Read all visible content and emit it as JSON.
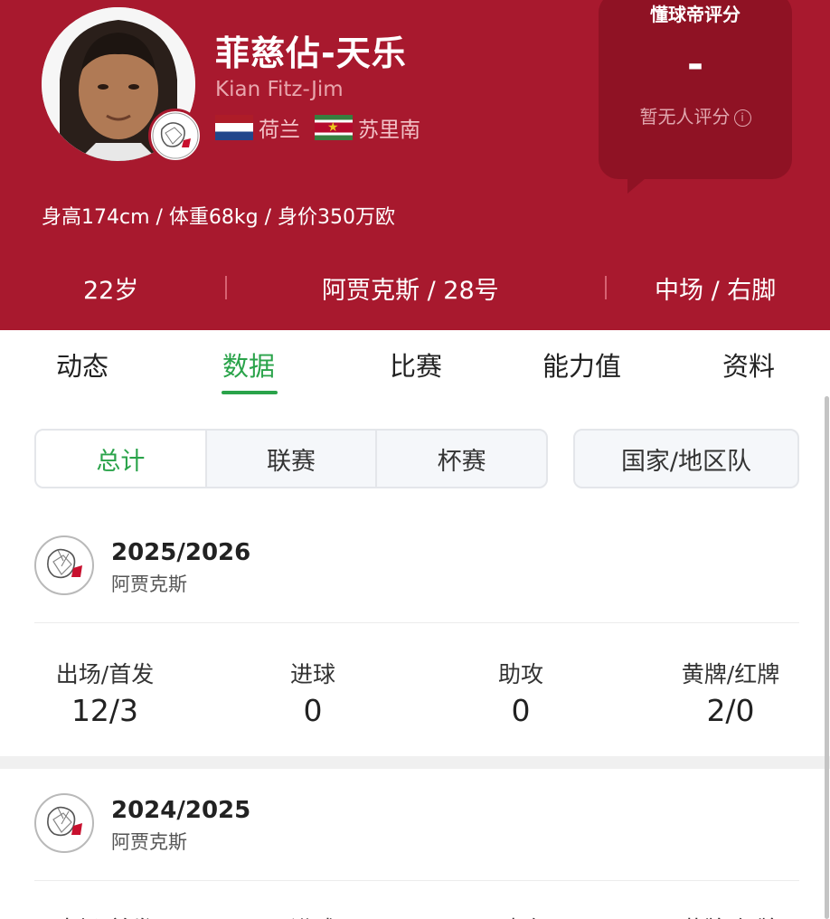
{
  "player": {
    "name_cn": "菲慈佔-天乐",
    "name_en": "Kian Fitz-Jim",
    "nationalities": [
      {
        "flag_icon": "netherlands-flag-icon",
        "label": "荷兰"
      },
      {
        "flag_icon": "suriname-flag-icon",
        "label": "苏里南"
      }
    ],
    "physical": "身高174cm / 体重68kg / 身价350万欧",
    "age": "22岁",
    "club_number": "阿贾克斯 / 28号",
    "position_foot": "中场 / 右脚"
  },
  "rating": {
    "title": "懂球帝评分",
    "value": "-",
    "note": "暂无人评分",
    "info_icon": "ⓘ"
  },
  "colors": {
    "header_bg": "#a8192e",
    "accent_green": "#2aa34a"
  },
  "tabs": [
    {
      "label": "动态",
      "active": false
    },
    {
      "label": "数据",
      "active": true
    },
    {
      "label": "比赛",
      "active": false
    },
    {
      "label": "能力值",
      "active": false
    },
    {
      "label": "资料",
      "active": false
    }
  ],
  "filters": {
    "segments": [
      {
        "label": "总计",
        "active": true
      },
      {
        "label": "联赛",
        "active": false
      },
      {
        "label": "杯赛",
        "active": false
      }
    ],
    "national_team": "国家/地区队"
  },
  "seasons": [
    {
      "year": "2025/2026",
      "club": "阿贾克斯",
      "stats": [
        {
          "label": "出场/首发",
          "value": "12/3"
        },
        {
          "label": "进球",
          "value": "0"
        },
        {
          "label": "助攻",
          "value": "0"
        },
        {
          "label": "黄牌/红牌",
          "value": "2/0"
        }
      ]
    },
    {
      "year": "2024/2025",
      "club": "阿贾克斯",
      "stats": [
        {
          "label": "出场/首发",
          "value": ""
        },
        {
          "label": "进球",
          "value": ""
        },
        {
          "label": "助攻",
          "value": ""
        },
        {
          "label": "黄牌/红牌",
          "value": ""
        }
      ]
    }
  ]
}
